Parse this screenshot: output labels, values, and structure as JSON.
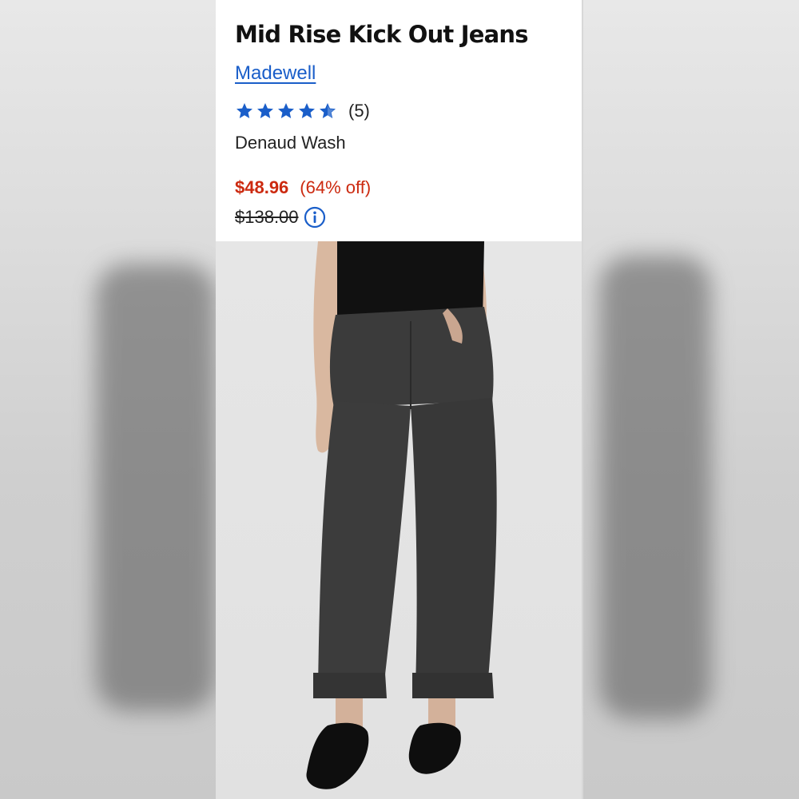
{
  "product": {
    "title": "Mid Rise Kick Out Jeans",
    "brand": "Madewell",
    "rating": {
      "stars": 5,
      "count_label": "(5)"
    },
    "color_name": "Denaud Wash",
    "sale_price": "$48.96",
    "discount": "(64% off)",
    "original_price": "$138.00"
  },
  "colors": {
    "brand_link": "#1a5ec9",
    "star": "#1a5ec9",
    "sale": "#cc2a10"
  },
  "icons": {
    "star": "star-icon",
    "info": "info-icon"
  }
}
